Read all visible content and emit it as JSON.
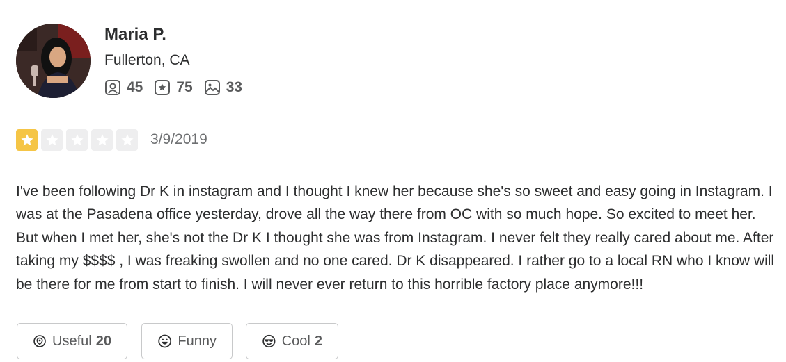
{
  "user": {
    "name": "Maria P.",
    "location": "Fullerton, CA",
    "stats": [
      {
        "icon": "friends-icon",
        "value": "45"
      },
      {
        "icon": "review-star-icon",
        "value": "75"
      },
      {
        "icon": "photo-icon",
        "value": "33"
      }
    ]
  },
  "rating": {
    "value": 1,
    "max": 5,
    "color_on": "#f5c546",
    "color_off": "#eeeeef"
  },
  "date": "3/9/2019",
  "review_text": "I've been following Dr K in instagram and I thought I knew her because she's so sweet and easy going in Instagram. I was at the Pasadena office yesterday, drove all the way there from OC with so much hope. So excited to meet her. But when I met her, she's not the Dr K I thought she was from Instagram. I never felt they really cared about me. After taking my $$$$ , I was freaking swollen and no one cared. Dr K disappeared. I rather go to a local RN who I know will be there for me from start to finish. I will never ever return to this horrible factory place anymore!!!",
  "reactions": {
    "useful": {
      "label": "Useful",
      "count": "20",
      "icon": "useful-icon"
    },
    "funny": {
      "label": "Funny",
      "icon": "funny-icon"
    },
    "cool": {
      "label": "Cool",
      "count": "2",
      "icon": "cool-icon"
    }
  }
}
